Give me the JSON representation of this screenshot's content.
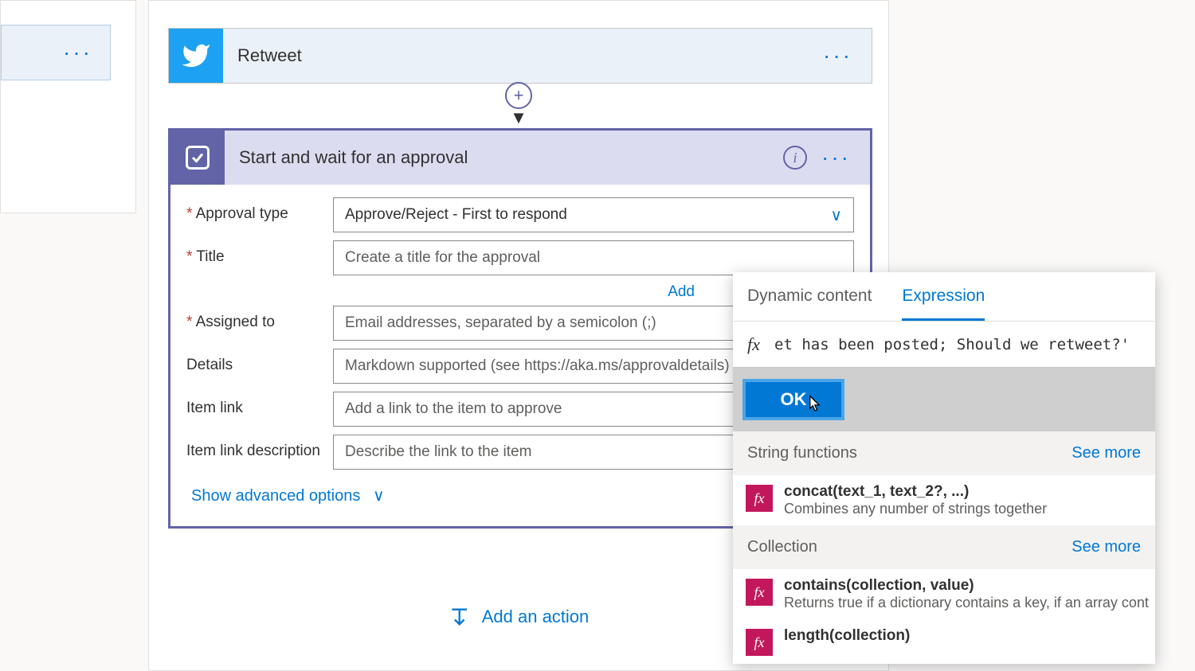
{
  "sidebar": {
    "dots": "···"
  },
  "retweet": {
    "title": "Retweet",
    "menu": "···"
  },
  "approval": {
    "title": "Start and wait for an approval",
    "info": "i",
    "menu": "···",
    "labels": {
      "approval_type": "Approval type",
      "title": "Title",
      "assigned_to": "Assigned to",
      "details": "Details",
      "item_link": "Item link",
      "item_link_desc": "Item link description"
    },
    "values": {
      "approval_type": "Approve/Reject - First to respond"
    },
    "placeholders": {
      "title": "Create a title for the approval",
      "assigned_to": "Email addresses, separated by a semicolon (;)",
      "details": "Markdown supported (see https://aka.ms/approvaldetails)",
      "item_link": "Add a link to the item to approve",
      "item_link_desc": "Describe the link to the item"
    },
    "add_link": "Add",
    "show_advanced": "Show advanced options"
  },
  "add_action": "Add an action",
  "expression_panel": {
    "tabs": {
      "dynamic": "Dynamic content",
      "expression": "Expression"
    },
    "active_tab": "expression",
    "fx": "fx",
    "input_value": "et has been posted; Should we retweet?'",
    "ok": "OK",
    "categories": [
      {
        "name": "String functions",
        "see_more": "See more",
        "items": [
          {
            "name": "concat(text_1, text_2?, ...)",
            "desc": "Combines any number of strings together"
          }
        ]
      },
      {
        "name": "Collection",
        "see_more": "See more",
        "items": [
          {
            "name": "contains(collection, value)",
            "desc": "Returns true if a dictionary contains a key, if an array cont"
          },
          {
            "name": "length(collection)",
            "desc": ""
          }
        ]
      }
    ]
  }
}
